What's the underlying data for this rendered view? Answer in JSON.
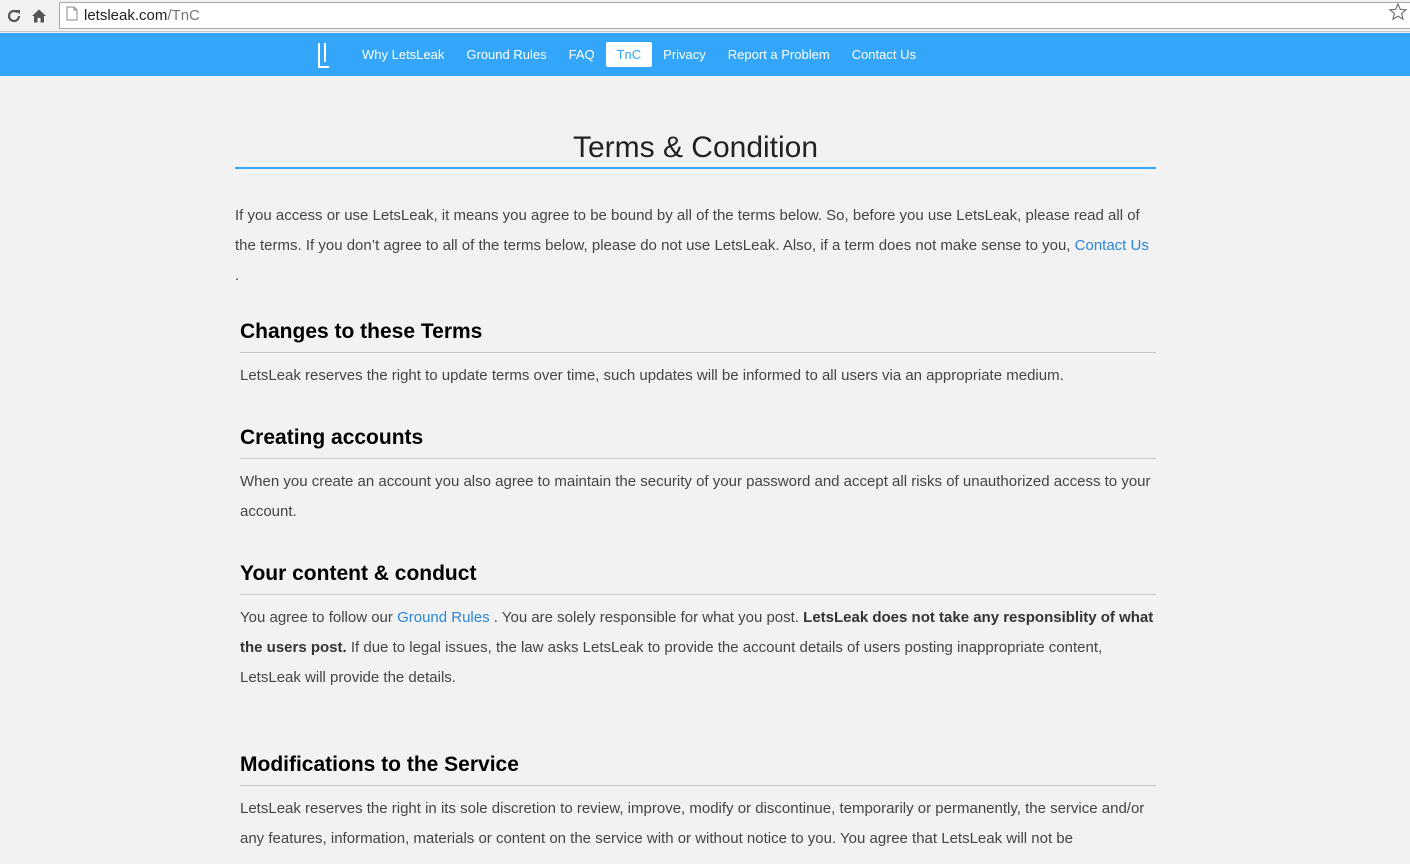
{
  "browser": {
    "url_host": "letsleak.com",
    "url_path": "/TnC"
  },
  "nav": {
    "items": [
      {
        "label": "Why LetsLeak",
        "active": false
      },
      {
        "label": "Ground Rules",
        "active": false
      },
      {
        "label": "FAQ",
        "active": false
      },
      {
        "label": "TnC",
        "active": true
      },
      {
        "label": "Privacy",
        "active": false
      },
      {
        "label": "Report a Problem",
        "active": false
      },
      {
        "label": "Contact Us",
        "active": false
      }
    ]
  },
  "page": {
    "title": "Terms & Condition",
    "intro_text": "If you access or use LetsLeak, it means you agree to be bound by all of the terms below. So, before you use LetsLeak, please read all of the terms. If you don’t agree to all of the terms below, please do not use LetsLeak. Also, if a term does not make sense to you, ",
    "intro_link": "Contact Us",
    "intro_end": " .",
    "sections": [
      {
        "heading": "Changes to these Terms",
        "body": "LetsLeak reserves the right to update terms over time, such updates will be informed to all users via an appropriate medium."
      },
      {
        "heading": "Creating accounts",
        "body": "When you create an account you also agree to maintain the security of your password and accept all risks of unauthorized access to your account."
      },
      {
        "heading": "Your content & conduct",
        "body_start": "You agree to follow our ",
        "body_link": "Ground Rules",
        "body_mid": " . You are solely responsible for what you post. ",
        "body_bold": "LetsLeak does not take any responsiblity of what the users post.",
        "body_end": " If due to legal issues, the law asks LetsLeak to provide the account details of users posting inappropriate content, LetsLeak will provide the details."
      },
      {
        "heading": "Modifications to the Service",
        "body": "LetsLeak reserves the right in its sole discretion to review, improve, modify or discontinue, temporarily or permanently, the service and/or any features, information, materials or content on the service with or without notice to you. You agree that LetsLeak will not be"
      }
    ]
  },
  "colors": {
    "brand_blue": "#33a6f9",
    "link_blue": "#2a86d8",
    "background": "#f2f2f2"
  }
}
